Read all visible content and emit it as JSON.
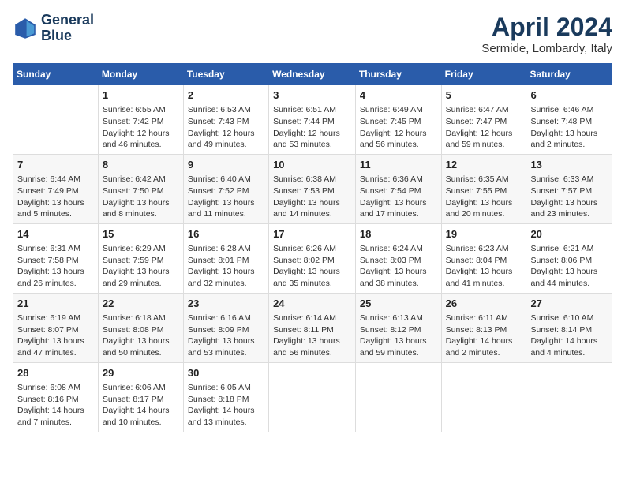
{
  "header": {
    "logo_line1": "General",
    "logo_line2": "Blue",
    "month_title": "April 2024",
    "location": "Sermide, Lombardy, Italy"
  },
  "days_of_week": [
    "Sunday",
    "Monday",
    "Tuesday",
    "Wednesday",
    "Thursday",
    "Friday",
    "Saturday"
  ],
  "weeks": [
    [
      {
        "day": "",
        "text": ""
      },
      {
        "day": "1",
        "text": "Sunrise: 6:55 AM\nSunset: 7:42 PM\nDaylight: 12 hours\nand 46 minutes."
      },
      {
        "day": "2",
        "text": "Sunrise: 6:53 AM\nSunset: 7:43 PM\nDaylight: 12 hours\nand 49 minutes."
      },
      {
        "day": "3",
        "text": "Sunrise: 6:51 AM\nSunset: 7:44 PM\nDaylight: 12 hours\nand 53 minutes."
      },
      {
        "day": "4",
        "text": "Sunrise: 6:49 AM\nSunset: 7:45 PM\nDaylight: 12 hours\nand 56 minutes."
      },
      {
        "day": "5",
        "text": "Sunrise: 6:47 AM\nSunset: 7:47 PM\nDaylight: 12 hours\nand 59 minutes."
      },
      {
        "day": "6",
        "text": "Sunrise: 6:46 AM\nSunset: 7:48 PM\nDaylight: 13 hours\nand 2 minutes."
      }
    ],
    [
      {
        "day": "7",
        "text": "Sunrise: 6:44 AM\nSunset: 7:49 PM\nDaylight: 13 hours\nand 5 minutes."
      },
      {
        "day": "8",
        "text": "Sunrise: 6:42 AM\nSunset: 7:50 PM\nDaylight: 13 hours\nand 8 minutes."
      },
      {
        "day": "9",
        "text": "Sunrise: 6:40 AM\nSunset: 7:52 PM\nDaylight: 13 hours\nand 11 minutes."
      },
      {
        "day": "10",
        "text": "Sunrise: 6:38 AM\nSunset: 7:53 PM\nDaylight: 13 hours\nand 14 minutes."
      },
      {
        "day": "11",
        "text": "Sunrise: 6:36 AM\nSunset: 7:54 PM\nDaylight: 13 hours\nand 17 minutes."
      },
      {
        "day": "12",
        "text": "Sunrise: 6:35 AM\nSunset: 7:55 PM\nDaylight: 13 hours\nand 20 minutes."
      },
      {
        "day": "13",
        "text": "Sunrise: 6:33 AM\nSunset: 7:57 PM\nDaylight: 13 hours\nand 23 minutes."
      }
    ],
    [
      {
        "day": "14",
        "text": "Sunrise: 6:31 AM\nSunset: 7:58 PM\nDaylight: 13 hours\nand 26 minutes."
      },
      {
        "day": "15",
        "text": "Sunrise: 6:29 AM\nSunset: 7:59 PM\nDaylight: 13 hours\nand 29 minutes."
      },
      {
        "day": "16",
        "text": "Sunrise: 6:28 AM\nSunset: 8:01 PM\nDaylight: 13 hours\nand 32 minutes."
      },
      {
        "day": "17",
        "text": "Sunrise: 6:26 AM\nSunset: 8:02 PM\nDaylight: 13 hours\nand 35 minutes."
      },
      {
        "day": "18",
        "text": "Sunrise: 6:24 AM\nSunset: 8:03 PM\nDaylight: 13 hours\nand 38 minutes."
      },
      {
        "day": "19",
        "text": "Sunrise: 6:23 AM\nSunset: 8:04 PM\nDaylight: 13 hours\nand 41 minutes."
      },
      {
        "day": "20",
        "text": "Sunrise: 6:21 AM\nSunset: 8:06 PM\nDaylight: 13 hours\nand 44 minutes."
      }
    ],
    [
      {
        "day": "21",
        "text": "Sunrise: 6:19 AM\nSunset: 8:07 PM\nDaylight: 13 hours\nand 47 minutes."
      },
      {
        "day": "22",
        "text": "Sunrise: 6:18 AM\nSunset: 8:08 PM\nDaylight: 13 hours\nand 50 minutes."
      },
      {
        "day": "23",
        "text": "Sunrise: 6:16 AM\nSunset: 8:09 PM\nDaylight: 13 hours\nand 53 minutes."
      },
      {
        "day": "24",
        "text": "Sunrise: 6:14 AM\nSunset: 8:11 PM\nDaylight: 13 hours\nand 56 minutes."
      },
      {
        "day": "25",
        "text": "Sunrise: 6:13 AM\nSunset: 8:12 PM\nDaylight: 13 hours\nand 59 minutes."
      },
      {
        "day": "26",
        "text": "Sunrise: 6:11 AM\nSunset: 8:13 PM\nDaylight: 14 hours\nand 2 minutes."
      },
      {
        "day": "27",
        "text": "Sunrise: 6:10 AM\nSunset: 8:14 PM\nDaylight: 14 hours\nand 4 minutes."
      }
    ],
    [
      {
        "day": "28",
        "text": "Sunrise: 6:08 AM\nSunset: 8:16 PM\nDaylight: 14 hours\nand 7 minutes."
      },
      {
        "day": "29",
        "text": "Sunrise: 6:06 AM\nSunset: 8:17 PM\nDaylight: 14 hours\nand 10 minutes."
      },
      {
        "day": "30",
        "text": "Sunrise: 6:05 AM\nSunset: 8:18 PM\nDaylight: 14 hours\nand 13 minutes."
      },
      {
        "day": "",
        "text": ""
      },
      {
        "day": "",
        "text": ""
      },
      {
        "day": "",
        "text": ""
      },
      {
        "day": "",
        "text": ""
      }
    ]
  ]
}
